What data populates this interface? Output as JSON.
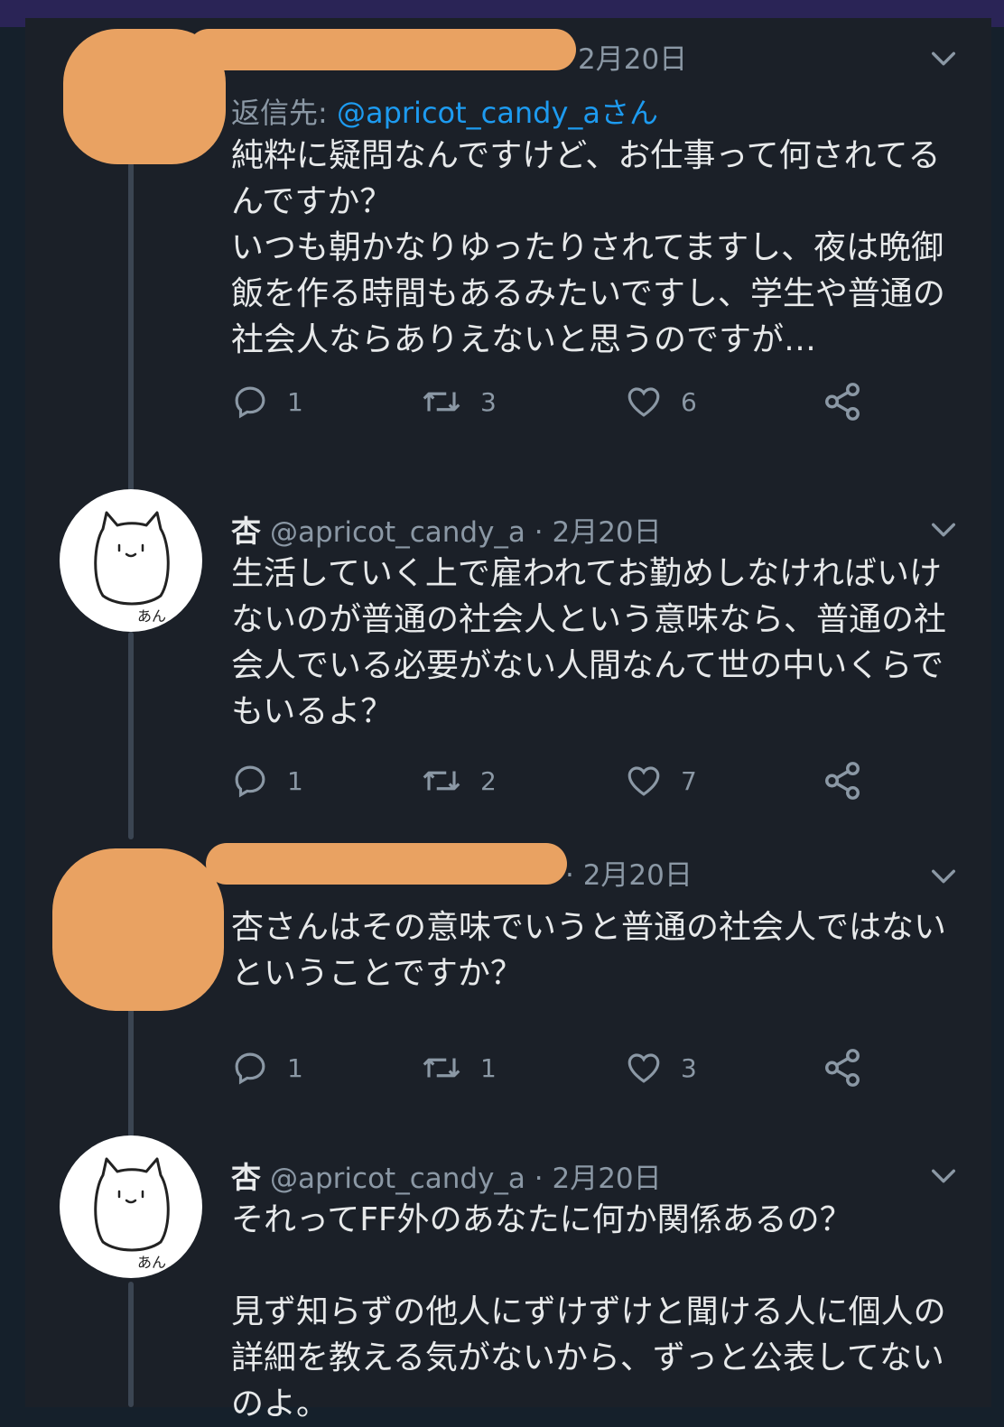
{
  "tweets": [
    {
      "name": "",
      "handle": "",
      "date": "2月20日",
      "reply_prefix": "返信先: ",
      "reply_mention": "@apricot_candy_a",
      "reply_suffix": "さん",
      "text": "純粋に疑問なんですけど、お仕事って何されてるんですか？\nいつも朝かなりゆったりされてますし、夜は晩御飯を作る時間もあるみたいですし、学生や普通の社会人ならありえないと思うのですが…",
      "replies": "1",
      "retweets": "3",
      "likes": "6"
    },
    {
      "name": "杏",
      "handle": "@apricot_candy_a",
      "date": "· 2月20日",
      "avatar_text": "あん",
      "text": "生活していく上で雇われてお勤めしなければいけないのが普通の社会人という意味なら、普通の社会人でいる必要がない人間なんて世の中いくらでもいるよ？",
      "replies": "1",
      "retweets": "2",
      "likes": "7"
    },
    {
      "name": "",
      "handle": "",
      "date": "· 2月20日",
      "text": "杏さんはその意味でいうと普通の社会人ではないということですか？",
      "replies": "1",
      "retweets": "1",
      "likes": "3"
    },
    {
      "name": "杏",
      "handle": "@apricot_candy_a",
      "date": "· 2月20日",
      "avatar_text": "あん",
      "text": "それってFF外のあなたに何か関係あるの？\n\n見ず知らずの他人にずけずけと聞ける人に個人の詳細を教える気がないから、ずっと公表してないのよ。"
    }
  ],
  "icons": {
    "reply": "reply-icon",
    "retweet": "retweet-icon",
    "like": "heart-icon",
    "share": "share-icon",
    "more": "chevron-down-icon"
  },
  "colors": {
    "background": "#1b2028",
    "text": "#e7e9ea",
    "muted": "#8b98a5",
    "link": "#1d9bf0",
    "redaction": "#e9a262"
  }
}
